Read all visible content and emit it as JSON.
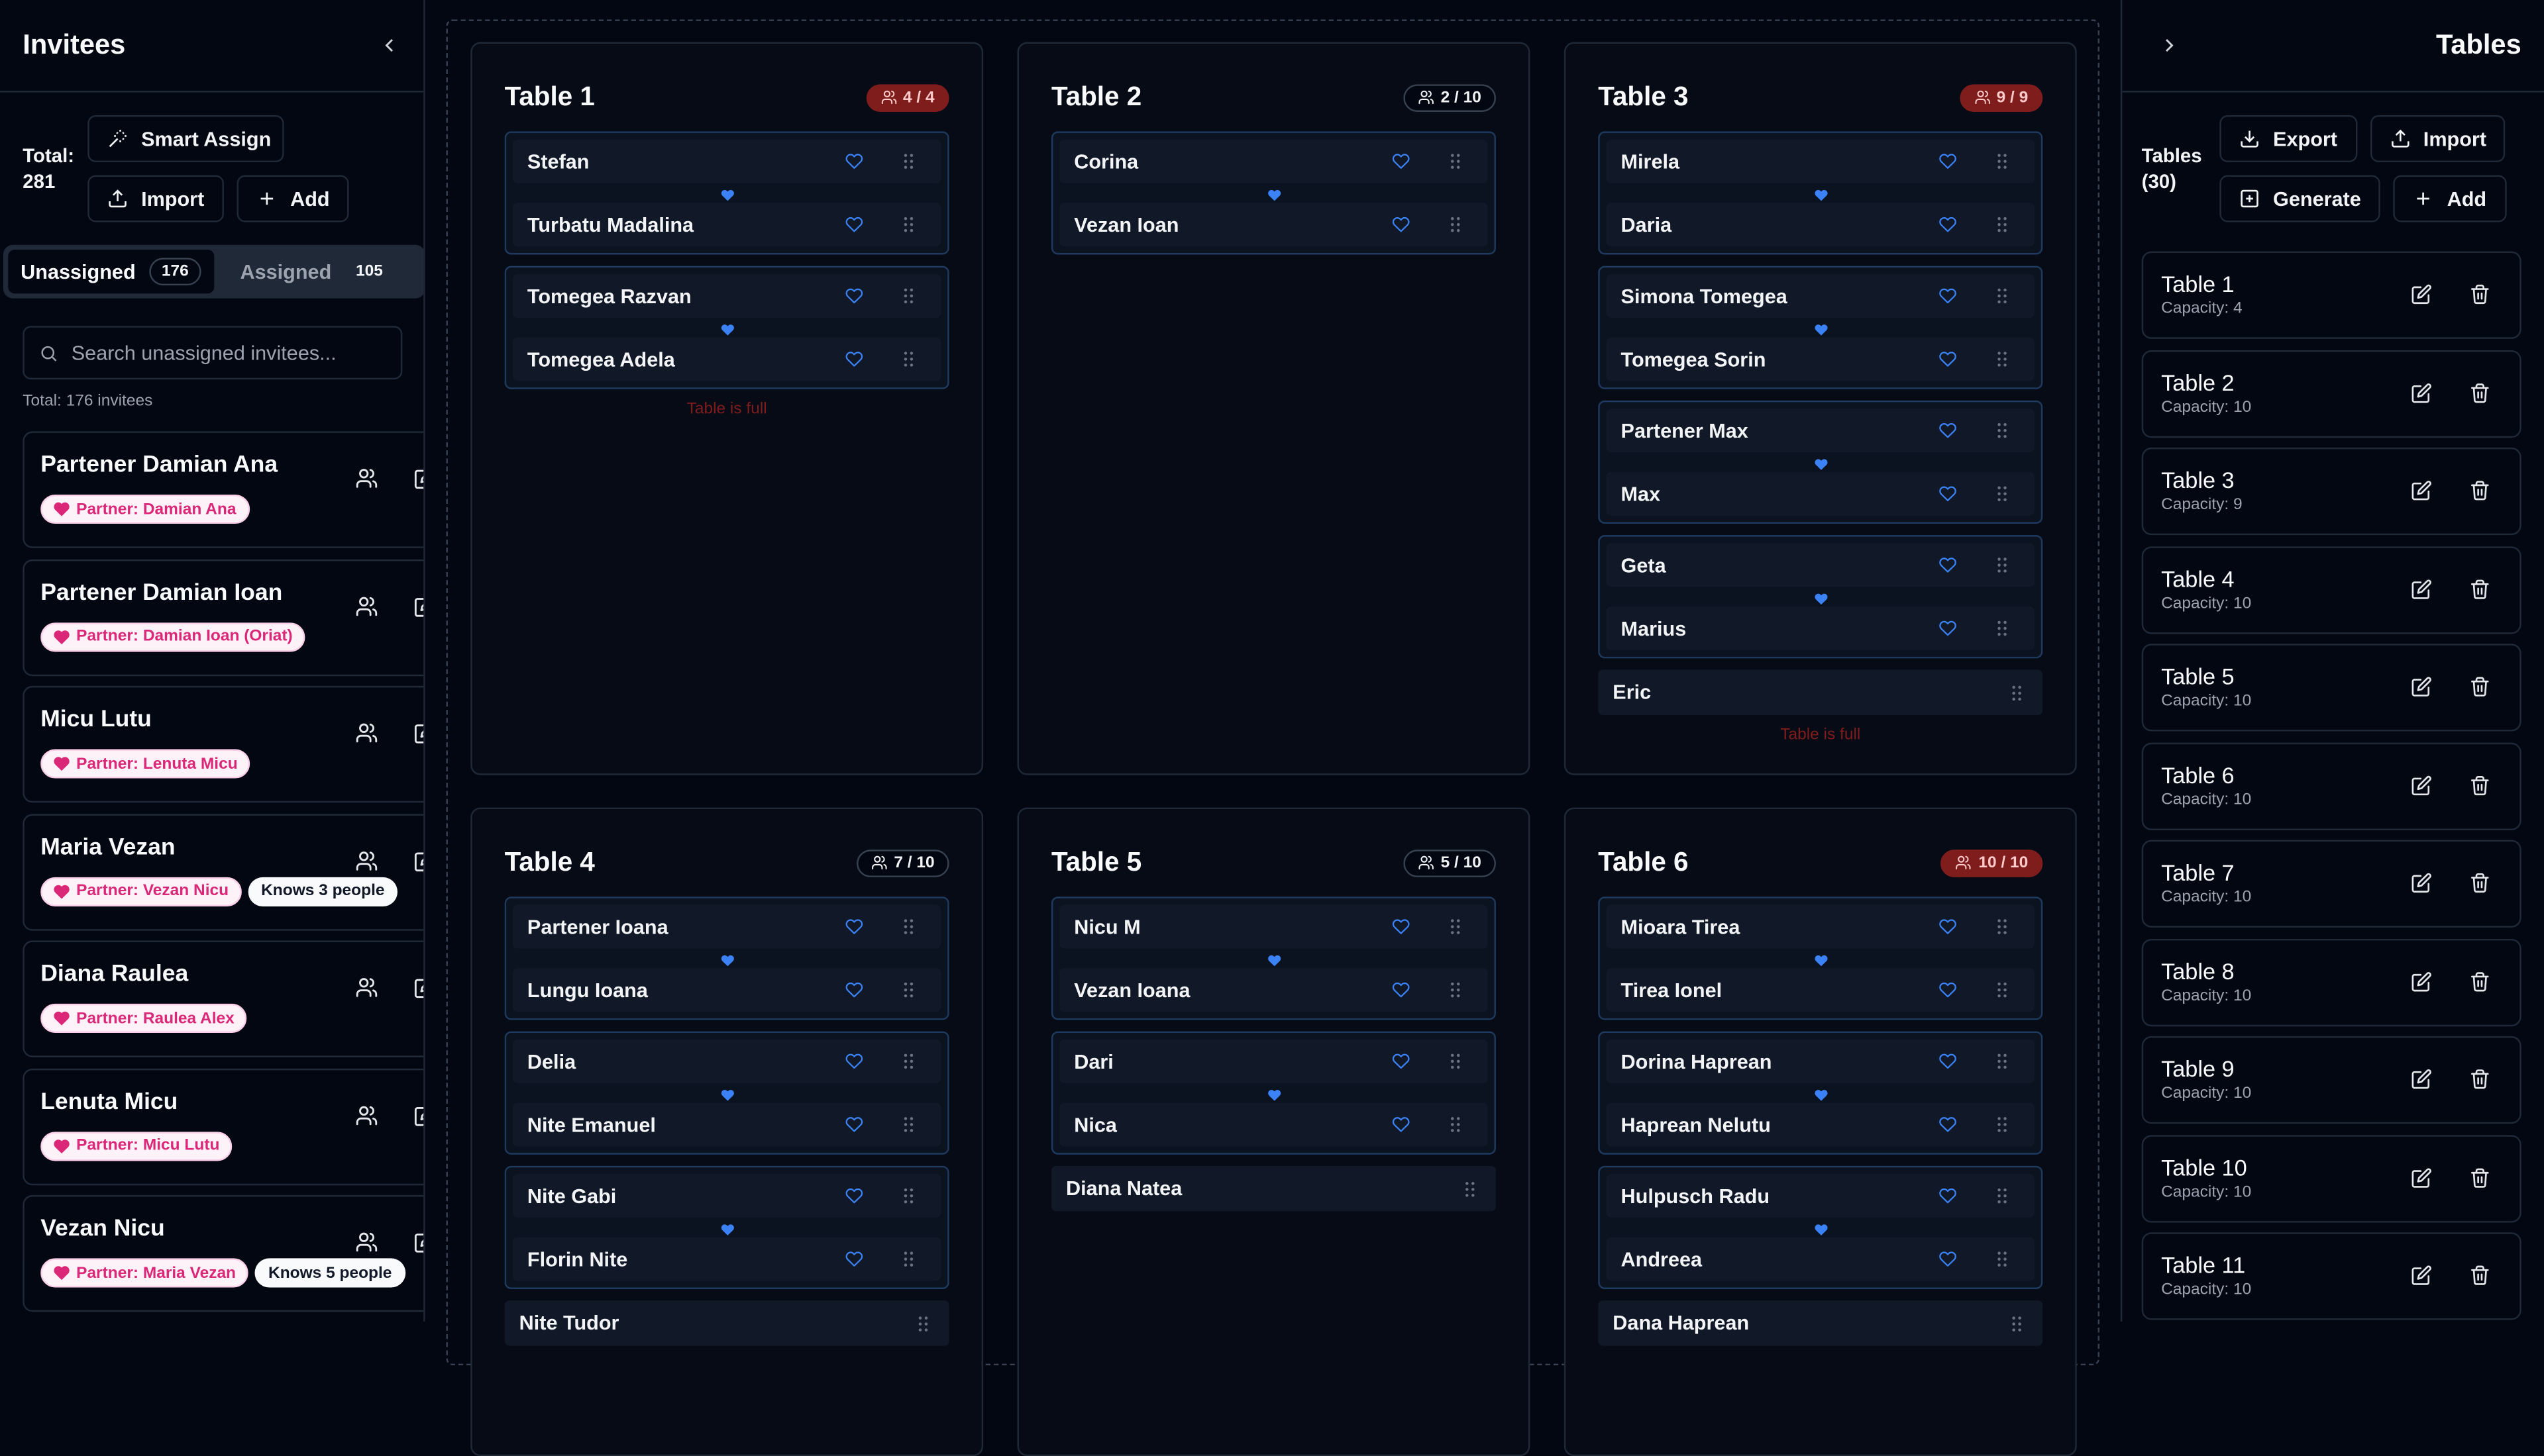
{
  "left": {
    "title": "Invitees",
    "total_label": "Total:",
    "total_value": "281",
    "smart_assign": "Smart Assign",
    "import": "Import",
    "add": "Add",
    "tab_unassigned": "Unassigned",
    "tab_unassigned_count": "176",
    "tab_assigned": "Assigned",
    "tab_assigned_count": "105",
    "search_placeholder": "Search unassigned invitees...",
    "subtotal": "Total: 176 invitees",
    "cards": [
      {
        "name": "Partener Damian Ana",
        "partner": "Partner: Damian Ana",
        "knows": ""
      },
      {
        "name": "Partener Damian Ioan",
        "partner": "Partner: Damian Ioan (Oriat)",
        "knows": ""
      },
      {
        "name": "Micu Lutu",
        "partner": "Partner: Lenuta Micu",
        "knows": ""
      },
      {
        "name": "Maria Vezan",
        "partner": "Partner: Vezan Nicu",
        "knows": "Knows 3 people"
      },
      {
        "name": "Diana Raulea",
        "partner": "Partner: Raulea Alex",
        "knows": ""
      },
      {
        "name": "Lenuta Micu",
        "partner": "Partner: Micu Lutu",
        "knows": ""
      },
      {
        "name": "Vezan Nicu",
        "partner": "Partner: Maria Vezan",
        "knows": "Knows 5 people"
      }
    ]
  },
  "board": {
    "tables": [
      {
        "name": "Table 1",
        "badge": "4 / 4",
        "full": true,
        "groups": [
          [
            "Stefan",
            "Turbatu Madalina"
          ],
          [
            "Tomegea Razvan",
            "Tomegea Adela"
          ]
        ],
        "singles": [],
        "full_msg": "Table is full"
      },
      {
        "name": "Table 2",
        "badge": "2 / 10",
        "full": false,
        "groups": [
          [
            "Corina",
            "Vezan Ioan"
          ]
        ],
        "singles": [],
        "full_msg": ""
      },
      {
        "name": "Table 3",
        "badge": "9 / 9",
        "full": true,
        "groups": [
          [
            "Mirela",
            "Daria"
          ],
          [
            "Simona Tomegea",
            "Tomegea Sorin"
          ],
          [
            "Partener Max",
            "Max"
          ],
          [
            "Geta",
            "Marius"
          ]
        ],
        "singles": [
          "Eric"
        ],
        "full_msg": "Table is full"
      },
      {
        "name": "Table 4",
        "badge": "7 / 10",
        "full": false,
        "groups": [
          [
            "Partener Ioana",
            "Lungu Ioana"
          ],
          [
            "Delia",
            "Nite Emanuel"
          ],
          [
            "Nite Gabi",
            "Florin Nite"
          ]
        ],
        "singles": [
          "Nite Tudor"
        ],
        "full_msg": ""
      },
      {
        "name": "Table 5",
        "badge": "5 / 10",
        "full": false,
        "groups": [
          [
            "Nicu M",
            "Vezan Ioana"
          ],
          [
            "Dari",
            "Nica"
          ]
        ],
        "singles": [
          "Diana Natea"
        ],
        "full_msg": ""
      },
      {
        "name": "Table 6",
        "badge": "10 / 10",
        "full": true,
        "groups": [
          [
            "Mioara Tirea",
            "Tirea Ionel"
          ],
          [
            "Dorina Haprean",
            "Haprean Nelutu"
          ],
          [
            "Hulpusch Radu",
            "Andreea"
          ]
        ],
        "singles": [
          "Dana Haprean"
        ],
        "full_msg": ""
      }
    ]
  },
  "right": {
    "title": "Tables",
    "tables_label": "Tables",
    "tables_count": "(30)",
    "export": "Export",
    "import": "Import",
    "generate": "Generate",
    "add": "Add",
    "items": [
      {
        "name": "Table 1",
        "capacity": "Capacity: 4"
      },
      {
        "name": "Table 2",
        "capacity": "Capacity: 10"
      },
      {
        "name": "Table 3",
        "capacity": "Capacity: 9"
      },
      {
        "name": "Table 4",
        "capacity": "Capacity: 10"
      },
      {
        "name": "Table 5",
        "capacity": "Capacity: 10"
      },
      {
        "name": "Table 6",
        "capacity": "Capacity: 10"
      },
      {
        "name": "Table 7",
        "capacity": "Capacity: 10"
      },
      {
        "name": "Table 8",
        "capacity": "Capacity: 10"
      },
      {
        "name": "Table 9",
        "capacity": "Capacity: 10"
      },
      {
        "name": "Table 10",
        "capacity": "Capacity: 10"
      },
      {
        "name": "Table 11",
        "capacity": "Capacity: 10"
      }
    ]
  },
  "colors": {
    "full_badge": "#7f1d1d",
    "heart": "#3b82f6",
    "partner_tag": "#db2777"
  },
  "icons": [
    "chevron-left-icon",
    "chevron-right-icon",
    "wand-icon",
    "upload-icon",
    "download-icon",
    "plus-icon",
    "plus-square-icon",
    "search-icon",
    "users-icon",
    "edit-icon",
    "trash-icon",
    "heart-icon",
    "grip-icon"
  ]
}
